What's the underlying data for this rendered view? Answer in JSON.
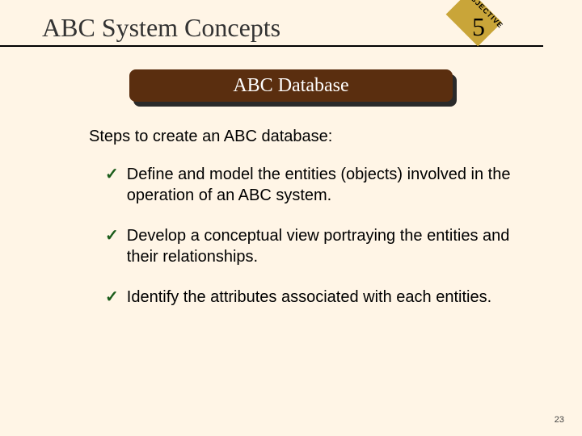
{
  "header": {
    "title": "ABC System Concepts",
    "badge_label": "OBJECTIVE",
    "badge_number": "5"
  },
  "subtitle": "ABC Database",
  "intro": "Steps to create an ABC database:",
  "bullets": [
    "Define and model the entities (objects) involved in the operation of an ABC system.",
    "Develop a conceptual view portraying the entities and their relationships.",
    "Identify the attributes associated with each entities."
  ],
  "page_number": "23"
}
